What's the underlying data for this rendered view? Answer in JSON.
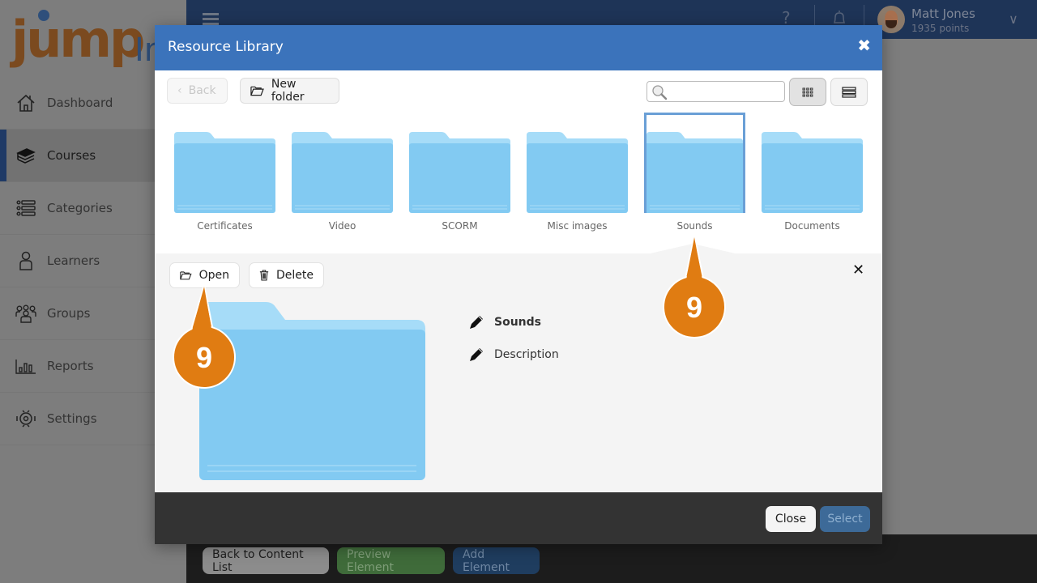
{
  "app": {
    "logo_text": "jump",
    "logo_suffix": "In"
  },
  "sidebar": {
    "items": [
      {
        "label": "Dashboard",
        "icon": "home-icon",
        "active": false
      },
      {
        "label": "Courses",
        "icon": "books-icon",
        "active": true
      },
      {
        "label": "Categories",
        "icon": "list-icon",
        "active": false
      },
      {
        "label": "Learners",
        "icon": "person-icon",
        "active": false
      },
      {
        "label": "Groups",
        "icon": "group-icon",
        "active": false
      },
      {
        "label": "Reports",
        "icon": "bar-chart-icon",
        "active": false
      },
      {
        "label": "Settings",
        "icon": "gear-icon",
        "active": false
      }
    ]
  },
  "topbar": {
    "help_glyph": "?",
    "user": {
      "name": "Matt Jones",
      "points": "1935 points"
    }
  },
  "footer_bar": {
    "back_label": "Back to Content List",
    "preview_label": "Preview Element",
    "add_label": "Add Element"
  },
  "modal": {
    "title": "Resource Library",
    "close_glyph": "✖",
    "toolbar": {
      "back_label": "Back",
      "new_folder_label": "New folder",
      "search_placeholder": "",
      "search_value": "",
      "view_mode": "grid"
    },
    "folders": [
      {
        "name": "Certificates",
        "selected": false
      },
      {
        "name": "Video",
        "selected": false
      },
      {
        "name": "SCORM",
        "selected": false
      },
      {
        "name": "Misc images",
        "selected": false
      },
      {
        "name": "Sounds",
        "selected": true
      },
      {
        "name": "Documents",
        "selected": false
      }
    ],
    "details": {
      "open_label": "Open",
      "delete_label": "Delete",
      "close_glyph": "✕",
      "name": "Sounds",
      "description_placeholder": "Description"
    },
    "footer": {
      "close_label": "Close",
      "select_label": "Select"
    }
  },
  "callouts": [
    {
      "number": "9",
      "target": "open-button"
    },
    {
      "number": "9",
      "target": "folder-sounds"
    }
  ],
  "colors": {
    "modal_header": "#3b73bb",
    "folder_blue": "#82caf2",
    "folder_tab": "#a6dcf8",
    "callout_orange": "#e07c12",
    "selected_border": "#6a9fd6",
    "topbar": "#1e3457"
  }
}
